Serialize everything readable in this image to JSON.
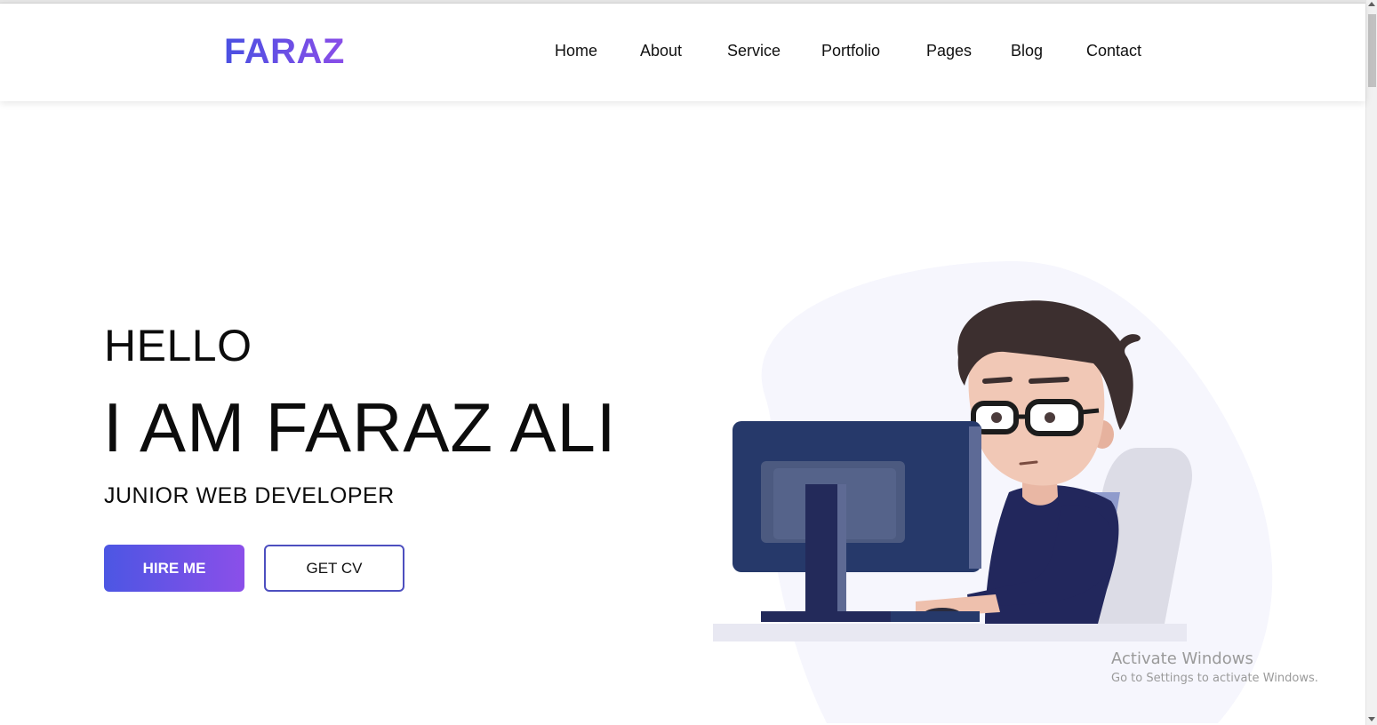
{
  "brand": {
    "logo_text": "FARAZ"
  },
  "nav": {
    "items": [
      {
        "label": "Home"
      },
      {
        "label": "About"
      },
      {
        "label": "Service"
      },
      {
        "label": "Portfolio"
      },
      {
        "label": "Pages"
      },
      {
        "label": "Blog"
      },
      {
        "label": "Contact"
      }
    ]
  },
  "hero": {
    "greeting": "HELLO",
    "headline": "I AM FARAZ ALI",
    "role": "JUNIOR WEB DEVELOPER",
    "primary_button": "HIRE ME",
    "secondary_button": "GET CV",
    "illustration_icon": "developer-at-computer-illustration"
  },
  "watermark": {
    "title": "Activate Windows",
    "subtitle": "Go to Settings to activate Windows."
  },
  "colors": {
    "accent_start": "#4c56e3",
    "accent_end": "#8b4fe9",
    "text": "#111111",
    "blob": "#f6f6fd"
  }
}
